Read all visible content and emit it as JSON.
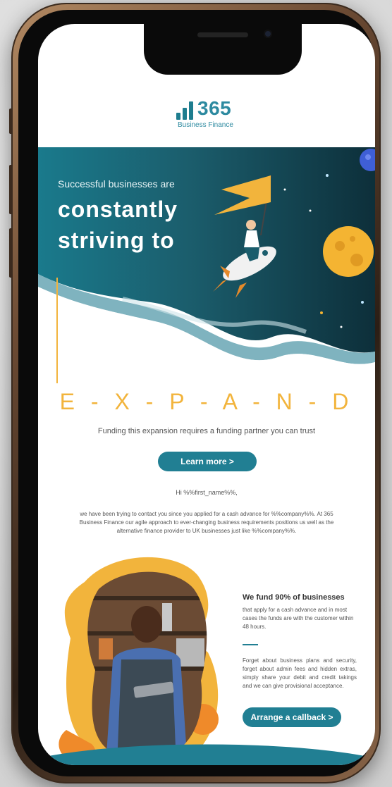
{
  "logo": {
    "number": "365",
    "subtitle": "Business Finance"
  },
  "hero": {
    "small_heading": "Successful businesses are",
    "big_line_1": "constantly",
    "big_line_2": "striving to"
  },
  "expand_word": "E - X - P - A - N - D",
  "tagline": "Funding this expansion requires a funding partner you can trust",
  "learn_more_label": "Learn more  >",
  "greeting": "Hi %%first_name%%,",
  "body_text": "we have been trying to contact you since you applied for a cash advance for %%company%%. At 365 Business Finance our agile approach to ever-changing business requirements positions us well as the alternative finance provider to UK businesses just like %%company%%.",
  "fund": {
    "title": "We fund 90% of businesses",
    "text": "that apply for a cash advance and in most cases the funds are with the customer within 48 hours.",
    "text2": "Forget about business plans and security, forget about admin fees and hidden extras, simply share your debit and credit takings and we can give provisional acceptance.",
    "cta_label": "Arrange a callback  >"
  },
  "colors": {
    "teal": "#217f93",
    "orange": "#f2b43c",
    "dark_teal": "#0f3d48"
  }
}
